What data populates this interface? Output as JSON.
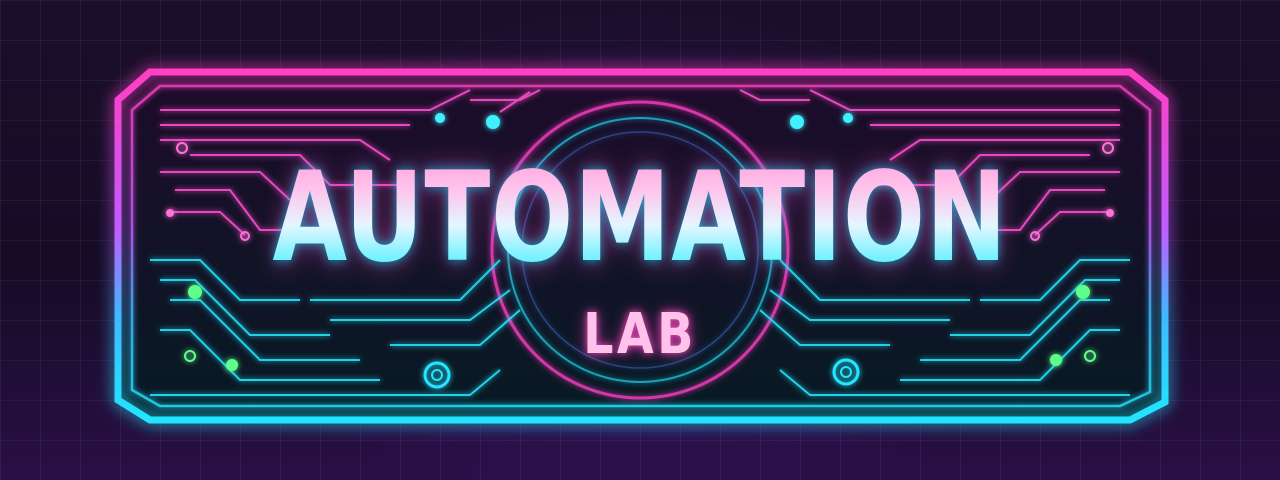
{
  "sign": {
    "title": "AUTOMATION",
    "subtitle": "LAB"
  },
  "colors": {
    "neon_pink": "#ff3fc4",
    "neon_cyan": "#22e6ff",
    "neon_green": "#5dff8a",
    "background": "#160c26"
  }
}
